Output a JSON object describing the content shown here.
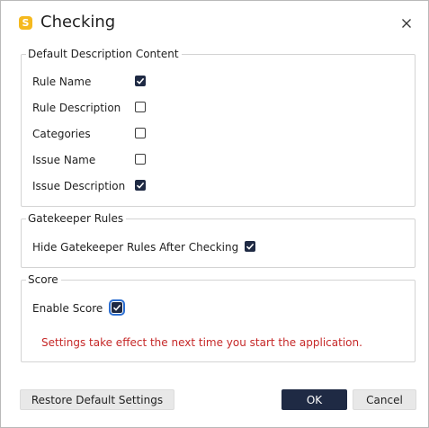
{
  "window": {
    "title": "Checking",
    "icon_letter": "S",
    "icon_color": "#f5b91e"
  },
  "groups": {
    "description": {
      "title": "Default Description Content",
      "items": [
        {
          "label": "Rule Name",
          "checked": true
        },
        {
          "label": "Rule Description",
          "checked": false
        },
        {
          "label": "Categories",
          "checked": false
        },
        {
          "label": "Issue Name",
          "checked": false
        },
        {
          "label": "Issue Description",
          "checked": true
        }
      ]
    },
    "gatekeeper": {
      "title": "Gatekeeper Rules",
      "items": [
        {
          "label": "Hide Gatekeeper Rules After Checking",
          "checked": true
        }
      ]
    },
    "score": {
      "title": "Score",
      "items": [
        {
          "label": "Enable Score",
          "checked": true
        }
      ],
      "notice": "Settings take effect the next time you start the application.",
      "notice_color": "#c62828"
    }
  },
  "buttons": {
    "restore": "Restore Default Settings",
    "ok": "OK",
    "cancel": "Cancel"
  },
  "colors": {
    "primary": "#1f2a44",
    "focus": "#2d6fd1"
  }
}
